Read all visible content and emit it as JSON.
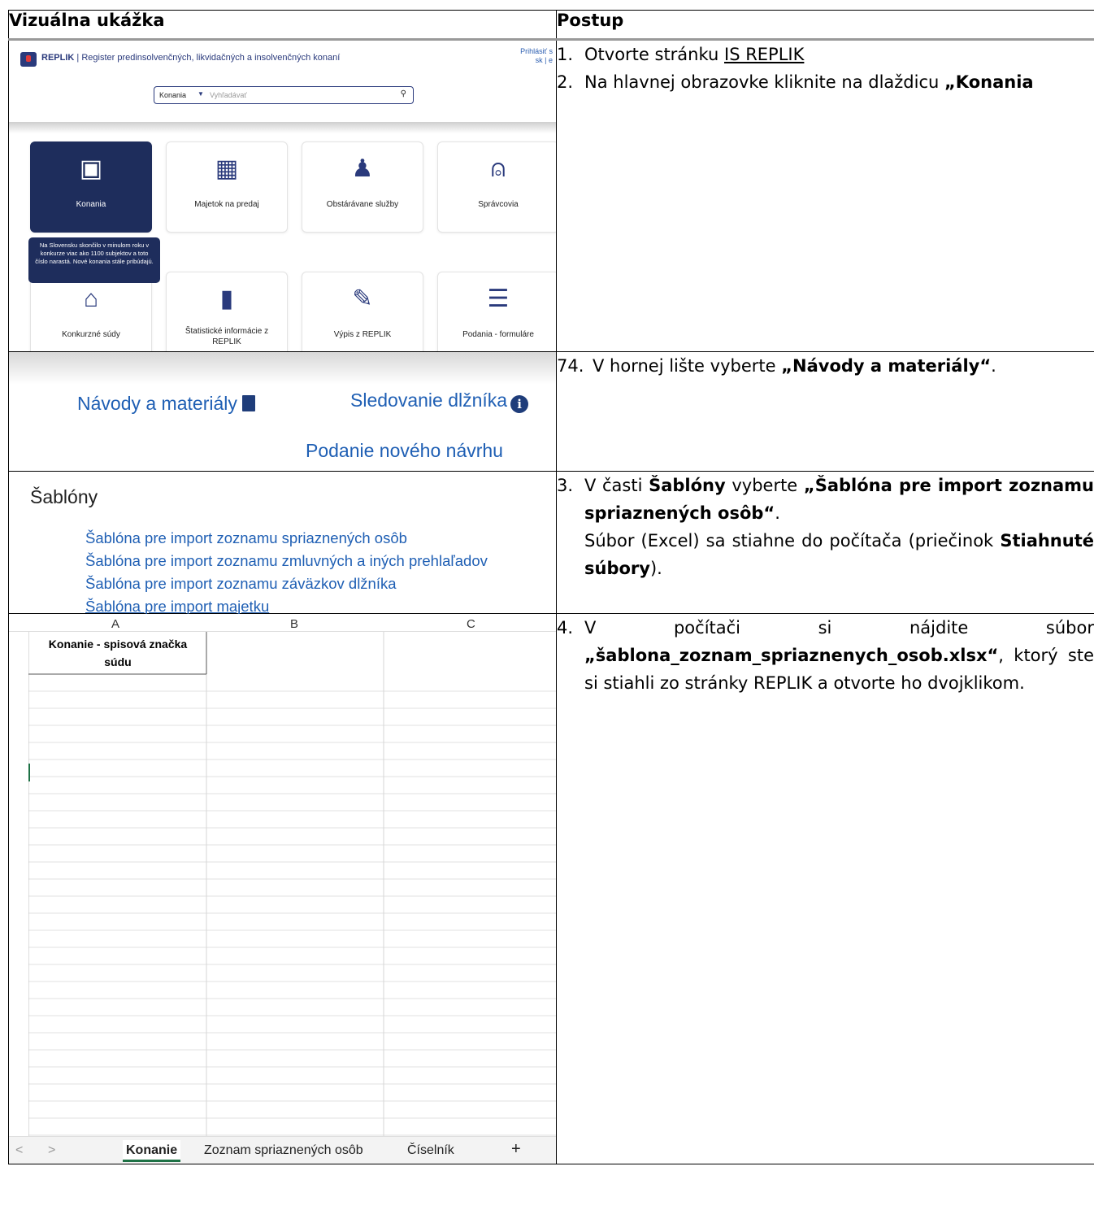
{
  "header": {
    "left": "Vizuálna ukážka",
    "right": "Postup"
  },
  "replik": {
    "brand": "REPLIK",
    "subtitle": "| Register predinsolvenčných, likvidačných a insolvenčných konaní",
    "login_line1": "Prihlásiť s",
    "login_line2": "sk | e",
    "search_select": "Konania",
    "search_placeholder": "Vyhľadávať",
    "tiles": [
      {
        "label": "Konania",
        "icon": "inbox-icon",
        "glyph": "▣"
      },
      {
        "label": "Majetok na predaj",
        "icon": "building-icon",
        "glyph": "▦"
      },
      {
        "label": "Obstárávane služby",
        "icon": "hand-person-icon",
        "glyph": "♟"
      },
      {
        "label": "Správcovia",
        "icon": "user-icon",
        "glyph": "⍝"
      },
      {
        "label": "Konkurzné súdy",
        "icon": "courthouse-icon",
        "glyph": "⌂"
      },
      {
        "label": "Štatistické informácie z REPLIK",
        "icon": "bar-chart-icon",
        "glyph": "▮"
      },
      {
        "label": "Výpis z REPLIK",
        "icon": "edit-document-icon",
        "glyph": "✎"
      },
      {
        "label": "Podania - formuláre",
        "icon": "lines-icon",
        "glyph": "☰"
      }
    ],
    "tooltip": "Na Slovensku skončilo v minulom roku v konkurze viac ako 1100 subjektov a toto číslo narastá. Nové konania stále pribúdajú."
  },
  "nav": {
    "guides": "Návody a materiály",
    "tracking": "Sledovanie dlžníka",
    "new_filing": "Podanie nového návrhu"
  },
  "templates": {
    "heading": "Šablóny",
    "items": [
      "Šablóna pre import zoznamu spriaznených osôb",
      "Šablóna pre import zoznamu zmluvných a iných prehlaľadov",
      "Šablóna pre import zoznamu záväzkov dlžníka",
      "Šablóna pre import majetku"
    ]
  },
  "excel": {
    "columns": [
      "A",
      "B",
      "C"
    ],
    "header_cell_line1": "Konanie - spisová značka",
    "header_cell_line2": "súdu",
    "sheets": [
      "Konanie",
      "Zoznam spriaznených osôb",
      "Číselník"
    ],
    "nav_prev": "<",
    "nav_next": ">",
    "add_sheet": "+"
  },
  "steps": {
    "s1_num": "1.",
    "s1_pre": "Otvorte stránku ",
    "s1_link": "IS REPLIK",
    "s2_num": "2.",
    "s2_text": "Na hlavnej obrazovke kliknite na dlaždicu ",
    "s2_bold": "„Konania",
    "s74_num": "74.",
    "s74_pre": "V hornej lište vyberte ",
    "s74_bold": "„Návody a materiály“",
    "s74_post": ".",
    "s3_num": "3.",
    "s3_pre": "V časti ",
    "s3_bold1": "Šablóny",
    "s3_mid": " vyberte ",
    "s3_bold2": "„Šablóna pre import zoznamu spriaznených osôb“",
    "s3_post": ".",
    "s3_line2_pre": "Súbor (Excel) sa stiahne do počítača (priečinok ",
    "s3_line2_bold": "Stiahnuté súbory",
    "s3_line2_post": ").",
    "s4_num": "4.",
    "s4_pre": "V počítači si nájdite súbor ",
    "s4_bold": "„šablona_zoznam_spriaznenych_osob.xlsx“",
    "s4_post": ", ktorý ste si stiahli zo stránky REPLIK a otvorte ho dvojklikom."
  }
}
